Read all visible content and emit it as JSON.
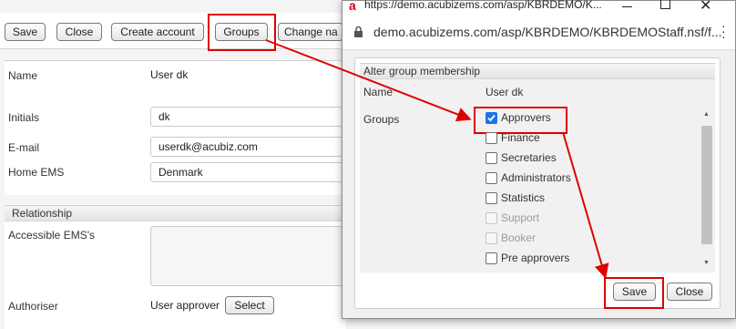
{
  "toolbar": {
    "save": "Save",
    "close": "Close",
    "create_account": "Create account",
    "groups": "Groups",
    "change_name": "Change na"
  },
  "form": {
    "name_label": "Name",
    "name_value": "User dk",
    "initials_label": "Initials",
    "initials_value": "dk",
    "email_label": "E-mail",
    "email_value": "userdk@acubiz.com",
    "home_ems_label": "Home EMS",
    "home_ems_value": "Denmark",
    "relationship_header": "Relationship",
    "accessible_ems_label": "Accessible EMS's",
    "authoriser_label": "Authoriser",
    "authoriser_value": "User approver",
    "select_button": "Select"
  },
  "popup": {
    "title_url": "https://demo.acubizems.com/asp/KBRDEMO/K...",
    "address": "demo.acubizems.com/asp/KBRDEMO/KBRDEMOStaff.nsf/f...",
    "header": "Alter group membership",
    "name_label": "Name",
    "name_value": "User dk",
    "groups_label": "Groups",
    "groups": [
      {
        "label": "Approvers",
        "checked": true,
        "disabled": false
      },
      {
        "label": "Finance",
        "checked": false,
        "disabled": false
      },
      {
        "label": "Secretaries",
        "checked": false,
        "disabled": false
      },
      {
        "label": "Administrators",
        "checked": false,
        "disabled": false
      },
      {
        "label": "Statistics",
        "checked": false,
        "disabled": false
      },
      {
        "label": "Support",
        "checked": false,
        "disabled": true
      },
      {
        "label": "Booker",
        "checked": false,
        "disabled": true
      },
      {
        "label": "Pre approvers",
        "checked": false,
        "disabled": false
      }
    ],
    "save": "Save",
    "close": "Close"
  },
  "colors": {
    "highlight": "#e00000",
    "checkbox_checked": "#1a73e8",
    "favicon": "#d6001c"
  }
}
